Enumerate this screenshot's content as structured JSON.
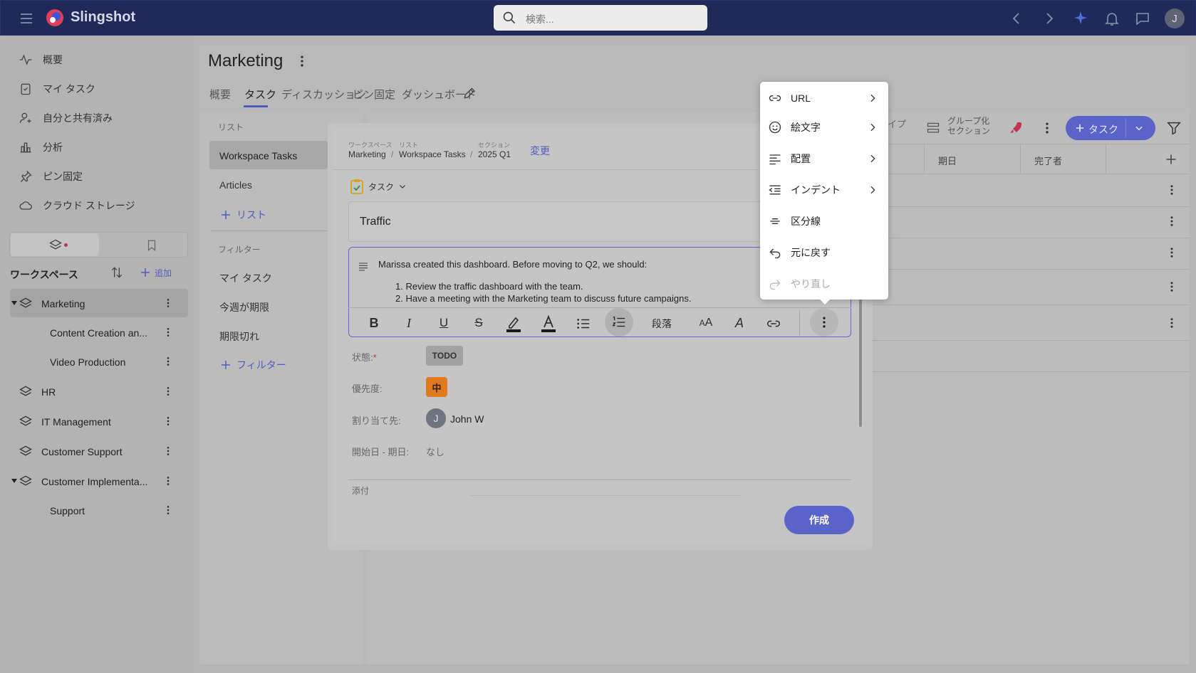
{
  "app": {
    "name": "Slingshot"
  },
  "header": {
    "search_placeholder": "検索..."
  },
  "sidebar": {
    "nav": [
      "概要",
      "マイ タスク",
      "自分と共有済み",
      "分析",
      "ピン固定",
      "クラウド ストレージ"
    ],
    "workspace_label": "ワークスペース",
    "add_label": "追加",
    "workspaces": [
      {
        "label": "Marketing",
        "level": 0,
        "selected": true
      },
      {
        "label": "Content Creation an...",
        "level": 1
      },
      {
        "label": "Video Production",
        "level": 1
      },
      {
        "label": "HR",
        "level": 0
      },
      {
        "label": "IT Management",
        "level": 0
      },
      {
        "label": "Customer Support",
        "level": 0
      },
      {
        "label": "Customer Implementa...",
        "level": 0
      },
      {
        "label": "Support",
        "level": 1
      }
    ]
  },
  "main": {
    "title": "Marketing",
    "tabs": [
      "概要",
      "タスク",
      "ディスカッション",
      "ピン固定",
      "ダッシュボード"
    ],
    "active_tab": "タスク",
    "lists_header": "リスト",
    "lists": [
      "Workspace Tasks",
      "Articles"
    ],
    "add_list": "リスト",
    "filters_header": "フィルター",
    "filters": [
      "マイ タスク",
      "今週が期限",
      "期限切れ"
    ],
    "add_filter": "フィルター",
    "toolbar": {
      "type_label": "イプ",
      "group_label": "グループ化",
      "group_sub": "セクション",
      "add_task": "タスク"
    },
    "columns": [
      "期日",
      "完了者"
    ]
  },
  "dialog": {
    "breadcrumb": [
      {
        "caption": "ワークスペース",
        "value": "Marketing"
      },
      {
        "caption": "リスト",
        "value": "Workspace Tasks"
      },
      {
        "caption": "セクション",
        "value": "2025 Q1"
      }
    ],
    "change_label": "変更",
    "type_label": "タスク",
    "task_title": "Traffic",
    "description_intro": "Marissa created this dashboard. Before moving to Q2, we should:",
    "description_items": [
      "1. Review the traffic dashboard with the team.",
      "2. Have a meeting with the Marketing team to discuss future campaigns."
    ],
    "paragraph_label": "段落",
    "fields": {
      "status_label": "状態:",
      "status_value": "TODO",
      "priority_label": "優先度:",
      "priority_value": "中",
      "assignee_label": "割り当て先:",
      "assignee_initial": "J",
      "assignee_name": "John W",
      "dates_label": "開始日 - 期日:",
      "dates_value": "なし"
    },
    "attachment_label": "添付",
    "create_label": "作成"
  },
  "menu": {
    "items": [
      {
        "label": "URL",
        "icon": "link-icon",
        "submenu": true
      },
      {
        "label": "絵文字",
        "icon": "emoji-icon",
        "submenu": true
      },
      {
        "label": "配置",
        "icon": "align-icon",
        "submenu": true
      },
      {
        "label": "インデント",
        "icon": "indent-icon",
        "submenu": true
      },
      {
        "label": "区分線",
        "icon": "divider-icon",
        "submenu": false
      },
      {
        "label": "元に戻す",
        "icon": "undo-icon",
        "submenu": false
      },
      {
        "label": "やり直し",
        "icon": "redo-icon",
        "submenu": false,
        "disabled": true
      }
    ]
  },
  "user": {
    "initial": "J"
  },
  "colors": {
    "header": "#1f2a5b",
    "accent": "#5a64c8",
    "priority": "#e07a1f"
  }
}
